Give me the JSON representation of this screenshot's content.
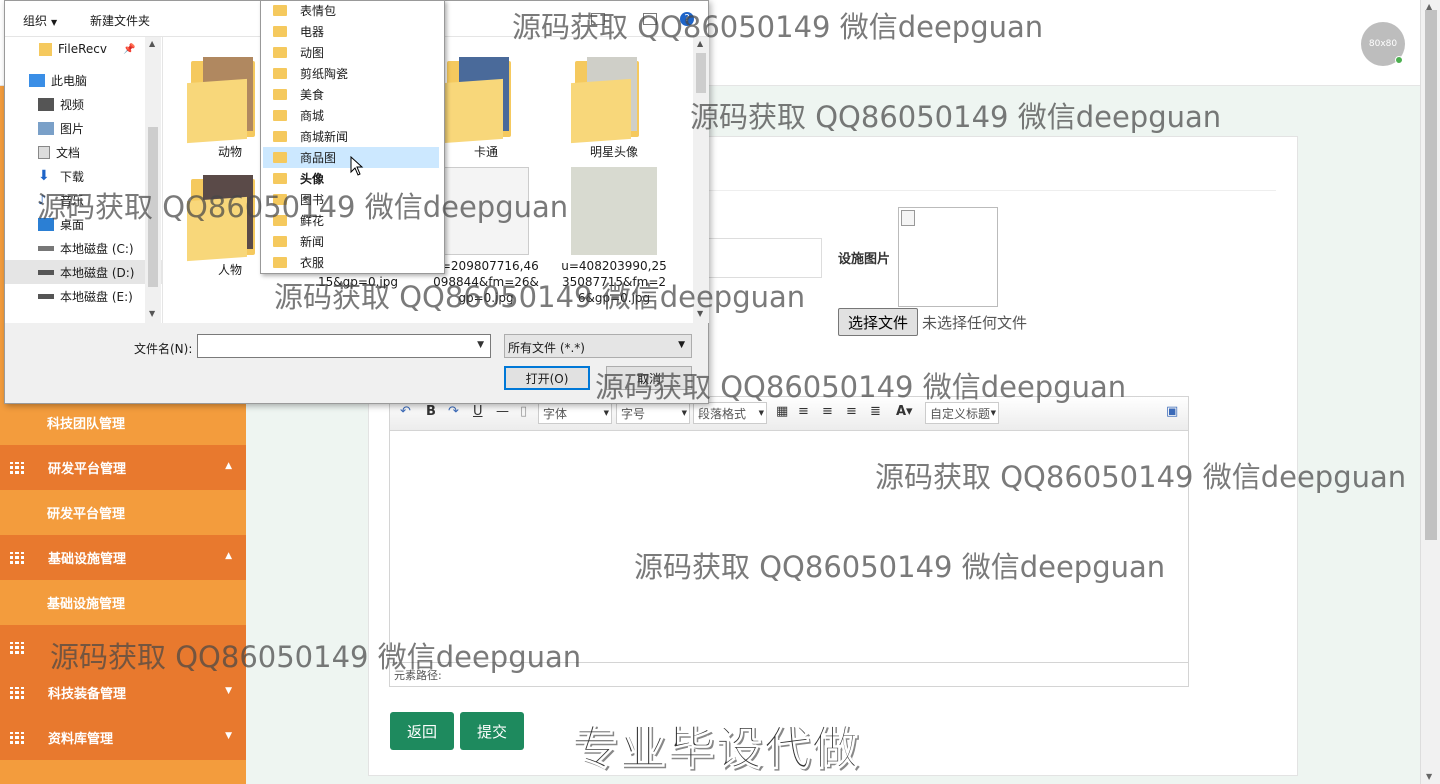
{
  "header": {
    "avatar_text": "80x80"
  },
  "sidebar": {
    "items": [
      {
        "label": "科技团队管理",
        "kind": "child"
      },
      {
        "label": "研发平台管理",
        "kind": "parent",
        "arrow": "▲"
      },
      {
        "label": "研发平台管理",
        "kind": "child"
      },
      {
        "label": "基础设施管理",
        "kind": "parent",
        "arrow": "▲"
      },
      {
        "label": "基础设施管理",
        "kind": "child"
      },
      {
        "label": "",
        "kind": "parent",
        "arrow": ""
      },
      {
        "label": "科技装备管理",
        "kind": "parent",
        "arrow": "▼"
      },
      {
        "label": "资料库管理",
        "kind": "parent",
        "arrow": "▼"
      }
    ]
  },
  "form": {
    "image_label": "设施图片",
    "choose_file_button": "选择文件",
    "no_file_text": "未选择任何文件",
    "editor": {
      "font_family_placeholder": "字体",
      "font_size_placeholder": "字号",
      "paragraph_placeholder": "段落格式",
      "custom_title_placeholder": "自定义标题",
      "path_label": "元素路径:"
    },
    "back_button": "返回",
    "submit_button": "提交"
  },
  "promo_text": "专业毕设代做",
  "dialog": {
    "toolbar": {
      "organize": "组织",
      "new_folder": "新建文件夹"
    },
    "nav": [
      {
        "label": "FileRecv",
        "icon": "folder-icon"
      },
      {
        "label": "此电脑",
        "icon": "computer-icon"
      },
      {
        "label": "视频",
        "icon": "video-icon"
      },
      {
        "label": "图片",
        "icon": "picture-icon"
      },
      {
        "label": "文档",
        "icon": "document-icon"
      },
      {
        "label": "下载",
        "icon": "download-icon"
      },
      {
        "label": "音乐",
        "icon": "music-icon"
      },
      {
        "label": "桌面",
        "icon": "desktop-icon"
      },
      {
        "label": "本地磁盘 (C:)",
        "icon": "drive-icon"
      },
      {
        "label": "本地磁盘 (D:)",
        "icon": "drive-icon"
      },
      {
        "label": "本地磁盘 (E:)",
        "icon": "drive-icon"
      }
    ],
    "files": [
      {
        "name": "动物",
        "type": "folder"
      },
      {
        "name": "卡通",
        "type": "folder"
      },
      {
        "name": "明星头像",
        "type": "folder"
      },
      {
        "name": "人物",
        "type": "folder"
      },
      {
        "name": "406988328&fm=15&gp=0.jpg",
        "type": "image"
      },
      {
        "name": "u=209807716,46098844&fm=26&gp=0.jpg",
        "type": "image"
      },
      {
        "name": "u=408203990,2535087715&fm=26&gp=0.jpg",
        "type": "image"
      }
    ],
    "filename_label": "文件名(N):",
    "filename_value": "",
    "filetype_value": "所有文件 (*.*)",
    "open_button": "打开(O)",
    "cancel_button": "取消"
  },
  "folder_dropdown": {
    "items": [
      "表情包",
      "电器",
      "动图",
      "剪纸陶瓷",
      "美食",
      "商城",
      "商城新闻",
      "商品图",
      "头像",
      "图书",
      "鲜花",
      "新闻",
      "衣服"
    ],
    "selected_index": 7,
    "bold_index": 8
  },
  "watermarks": [
    "源码获取 QQ86050149 微信deepguan",
    "源码获取 QQ86050149 微信deepguan",
    "源码获取 QQ86050149 微信deepguan",
    "源码获取 QQ86050149 微信deepguan",
    "源码获取 QQ86050149 微信deepguan",
    "源码获取 QQ86050149 微信deepguan",
    "源码获取 QQ86050149 微信deepguan",
    "源码获取 QQ86050149 微信deepguan"
  ],
  "colors": {
    "sidebar": "#f39c3d",
    "sidebar_parent": "#e8792e",
    "button_green": "#1e8a5e",
    "content_bg": "#eef5f1"
  }
}
